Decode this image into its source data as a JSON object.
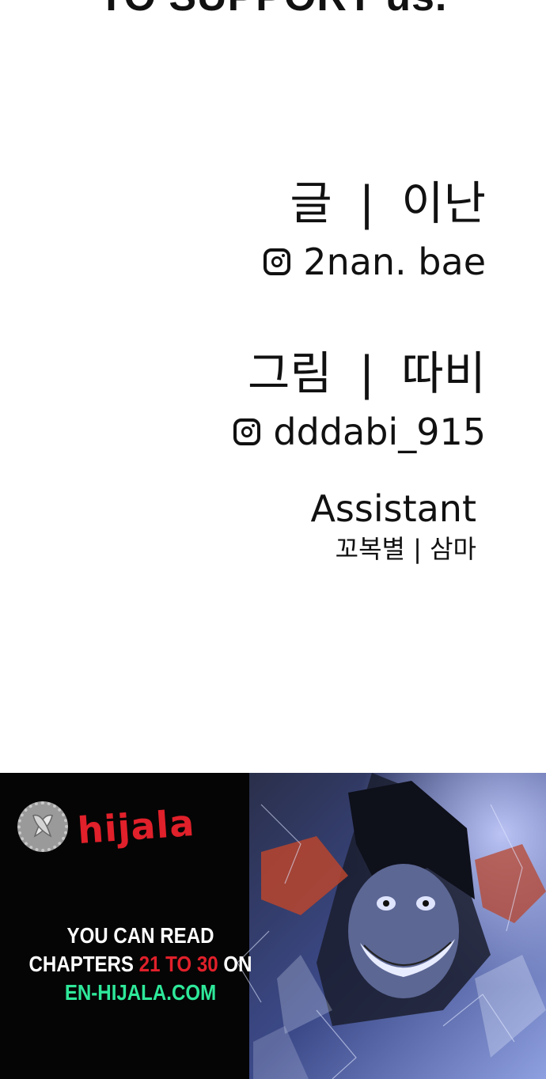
{
  "top_banner": {
    "text": "TO SUPPORT us."
  },
  "credits": {
    "writer": {
      "role": "글",
      "separator": "|",
      "name": "이난",
      "handle": "2nan. bae"
    },
    "artist": {
      "role": "그림",
      "separator": "|",
      "name": "따비",
      "handle": "dddabi_915"
    },
    "assistant": {
      "title": "Assistant",
      "names": "꼬복별 | 삼마"
    }
  },
  "promo": {
    "logo_text": "hijala",
    "line1": "YOU CAN READ",
    "line2_prefix": "CHAPTERS",
    "line2_range": "21 TO 30",
    "line2_suffix": "ON",
    "site": "EN-HIJALA.COM"
  },
  "icons": [
    "instagram-icon",
    "hijala-logo-icon"
  ],
  "colors": {
    "accent_red": "#e0202a",
    "accent_green": "#2ee89a",
    "promo_bg": "#000000"
  }
}
